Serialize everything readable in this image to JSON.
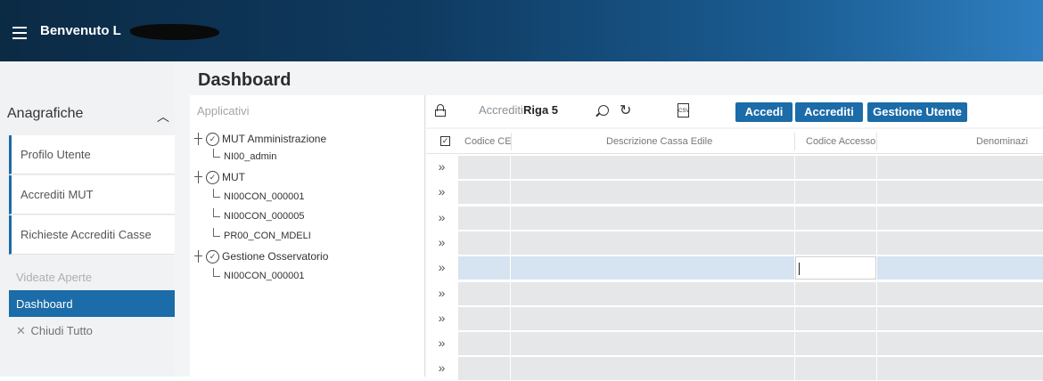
{
  "header": {
    "menu_icon": "hamburger-icon",
    "welcome": "Benvenuto L",
    "welcome_tail": ""
  },
  "sidebar": {
    "section": {
      "label": "Anagrafiche",
      "icon": "chevron-up-icon"
    },
    "items": [
      {
        "label": "Profilo Utente"
      },
      {
        "label": "Accrediti MUT"
      },
      {
        "label": "Richieste Accrediti Casse"
      }
    ],
    "opened_label": "Videate Aperte",
    "active": "Dashboard",
    "close_all": "Chiudi Tutto"
  },
  "main": {
    "title": "Dashboard",
    "apps": {
      "header": "Applicativi",
      "tree": [
        {
          "label": "MUT Amministrazione",
          "children": [
            "NI00_admin"
          ]
        },
        {
          "label": "MUT",
          "children": [
            "NI00CON_000001",
            "NI00CON_000005",
            "PR00_CON_MDELI"
          ]
        },
        {
          "label": "Gestione Osservatorio",
          "children": [
            "NI00CON_000001"
          ]
        }
      ]
    },
    "toolbar": {
      "accrediti_label": "Accrediti:",
      "accrediti_value": "Riga 5",
      "csv": "CSV",
      "buttons": {
        "accedi": "Accedi",
        "accrediti": "Accrediti",
        "gestione_utente": "Gestione Utente"
      }
    },
    "grid": {
      "columns": [
        "Codice CE",
        "Descrizione Cassa Edile",
        "Codice Accesso",
        "Denominazi"
      ],
      "rows": 9,
      "selected_row": 5,
      "expander": "»"
    }
  },
  "colors": {
    "accent": "#1b6ca8",
    "header_dark": "#0b2a44",
    "header_light": "#2f7ec0",
    "row_cell": "#e6e7e8",
    "row_selected": "#d6e3f1"
  }
}
